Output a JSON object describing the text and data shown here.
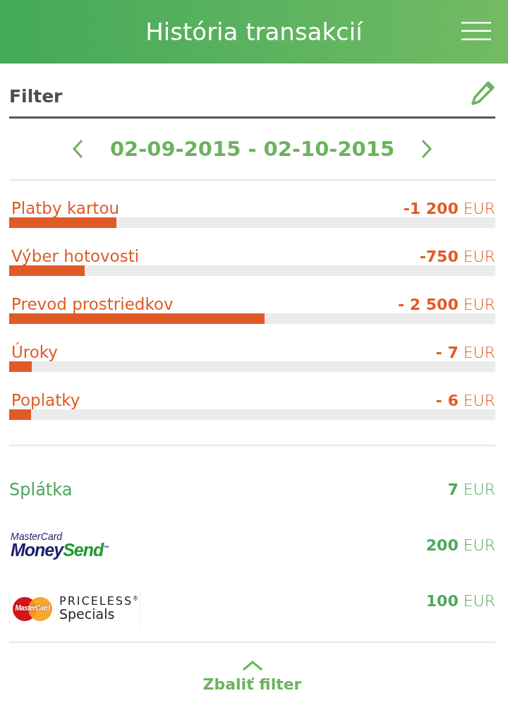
{
  "header": {
    "title": "História transakcií"
  },
  "filter": {
    "label": "Filter",
    "date_range": "02-09-2015 - 02-10-2015"
  },
  "debits": [
    {
      "label": "Platby kartou",
      "amount": "-1 200",
      "currency": "EUR",
      "level": 0.22
    },
    {
      "label": "Výber hotovosti",
      "amount": "-750",
      "currency": "EUR",
      "level": 0.155
    },
    {
      "label": "Prevod prostriedkov",
      "amount": "- 2 500",
      "currency": "EUR",
      "level": 0.526
    },
    {
      "label": "Úroky",
      "amount": "- 7",
      "currency": "EUR",
      "level": 0.047
    },
    {
      "label": "Poplatky",
      "amount": "- 6",
      "currency": "EUR",
      "level": 0.045
    }
  ],
  "credits": [
    {
      "kind": "text",
      "label": "Splátka",
      "amount": "7",
      "currency": "EUR"
    },
    {
      "kind": "moneysend",
      "brand": "MasterCard",
      "name_first": "Money",
      "name_second": "Send",
      "trademark": "™",
      "amount": "200",
      "currency": "EUR"
    },
    {
      "kind": "priceless",
      "badge": "MasterCard",
      "name_first": "PRICELESS",
      "trademark": "®",
      "name_second": "Specials",
      "amount": "100",
      "currency": "EUR"
    }
  ],
  "footer": {
    "label": "Zbaliť filter"
  }
}
